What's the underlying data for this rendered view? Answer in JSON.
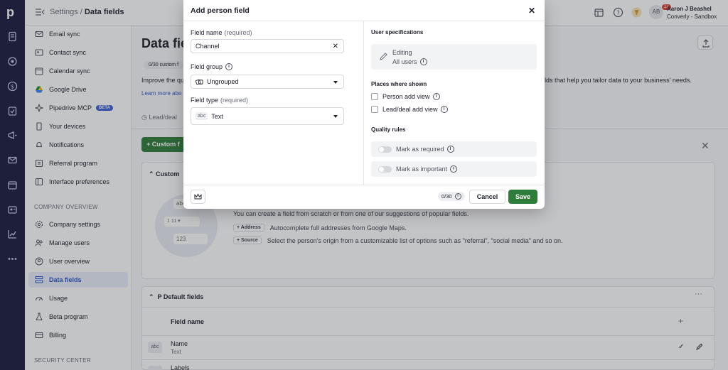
{
  "rail": {
    "logo": "p"
  },
  "topbar": {
    "breadcrumb_parent": "Settings",
    "breadcrumb_sep": " / ",
    "breadcrumb_current": "Data fields",
    "notifications_badge": "1+",
    "avatar_initials": "AB",
    "user_name": "Aaron J Beashel",
    "company": "Converly - Sandbox"
  },
  "sidebar": {
    "items": [
      {
        "label": "Email sync",
        "icon": "mail-icon"
      },
      {
        "label": "Contact sync",
        "icon": "contact-sync-icon"
      },
      {
        "label": "Calendar sync",
        "icon": "calendar-icon"
      },
      {
        "label": "Google Drive",
        "icon": "google-drive-icon"
      },
      {
        "label": "Pipedrive MCP",
        "icon": "mcp-icon",
        "badge": "BETA"
      },
      {
        "label": "Your devices",
        "icon": "device-icon"
      },
      {
        "label": "Notifications",
        "icon": "bell-icon"
      },
      {
        "label": "Referral program",
        "icon": "referral-icon"
      },
      {
        "label": "Interface preferences",
        "icon": "interface-icon"
      }
    ],
    "section_company": "COMPANY OVERVIEW",
    "company_items": [
      {
        "label": "Company settings",
        "icon": "gear-icon"
      },
      {
        "label": "Manage users",
        "icon": "users-icon"
      },
      {
        "label": "User overview",
        "icon": "user-overview-icon"
      },
      {
        "label": "Data fields",
        "icon": "data-fields-icon",
        "active": true
      },
      {
        "label": "Usage",
        "icon": "usage-icon"
      },
      {
        "label": "Beta program",
        "icon": "flask-icon"
      },
      {
        "label": "Billing",
        "icon": "billing-icon"
      }
    ],
    "section_security": "SECURITY CENTER"
  },
  "main": {
    "title": "Data fie",
    "count_chip": "0/30 custom f",
    "intro_left": "Improve the qu",
    "intro_right": "elds that help you tailor data to your business' needs.",
    "learn_more": "Learn more abo",
    "tab_label": "Lead/deal",
    "custom_button": "+ Custom f",
    "custom_card": {
      "header": "Custom",
      "illus_box1": "abc",
      "illus_box2": "1   11  ▾",
      "illus_box3": "123",
      "description": "You can create a field from scratch or from one of our suggestions of popular fields.",
      "suggestions": [
        {
          "chip": "+ Address",
          "text": "Autocomplete full addresses from Google Maps."
        },
        {
          "chip": "+ Source",
          "text": "Select the person's origin from a customizable list of options such as \"referral\", \"social media\" and so on."
        }
      ]
    },
    "default_card": {
      "header": "Default fields",
      "column_header": "Field name",
      "rows": [
        {
          "type_chip": "abc",
          "name": "Name",
          "type": "Text"
        },
        {
          "type_chip": "",
          "name": "Labels",
          "type": ""
        }
      ]
    }
  },
  "modal": {
    "title": "Add person field",
    "field_name_label": "Field name",
    "required_suffix": "(required)",
    "field_name_value": "Channel",
    "field_group_label": "Field group",
    "field_group_value": "Ungrouped",
    "field_type_label": "Field type",
    "field_type_chip": "abc",
    "field_type_value": "Text",
    "user_spec_title": "User specifications",
    "spec_line1": "Editing",
    "spec_line2": "All users",
    "places_title": "Places where shown",
    "places": [
      "Person add view",
      "Lead/deal add view"
    ],
    "quality_title": "Quality rules",
    "quality": [
      "Mark as required",
      "Mark as important"
    ],
    "counter": "0/30",
    "cancel": "Cancel",
    "save": "Save"
  },
  "colors": {
    "rail": "#1b1c3f",
    "primary_green": "#2e7d3a",
    "active_blue": "#2a54c5",
    "badge_red": "#e0443a"
  }
}
